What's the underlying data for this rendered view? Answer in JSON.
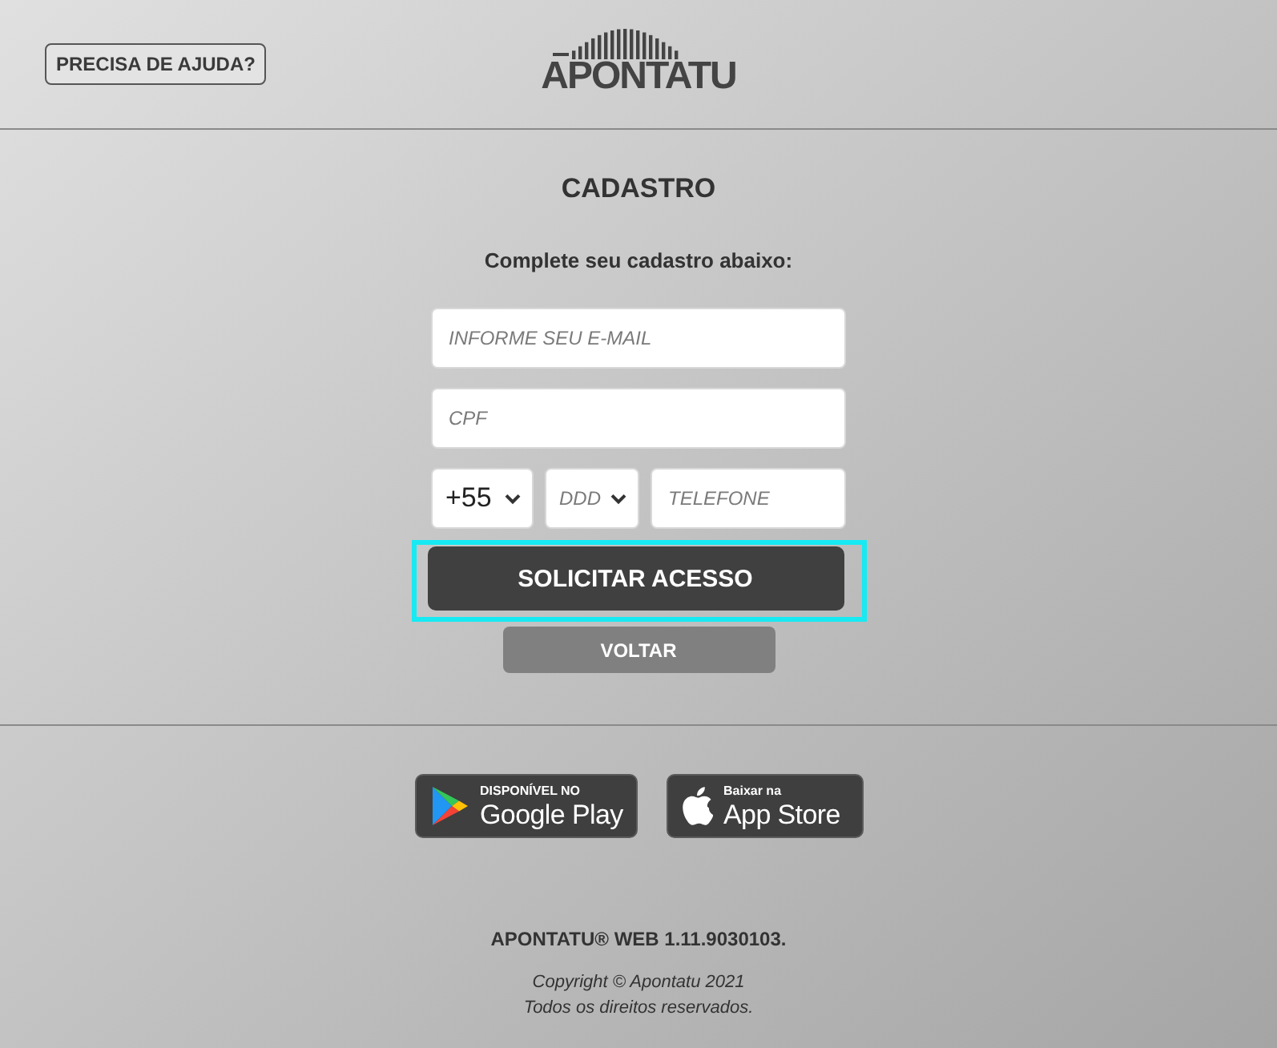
{
  "header": {
    "help_button": "PRECISA DE AJUDA?",
    "logo": "APONTATU"
  },
  "form": {
    "title": "CADASTRO",
    "subtitle": "Complete seu cadastro abaixo:",
    "email_field": {
      "placeholder": "INFORME SEU E-MAIL"
    },
    "cpf_field": {
      "placeholder": "CPF"
    },
    "country_code_select": {
      "value": "+55"
    },
    "ddd_select": {
      "placeholder": "DDD"
    },
    "phone_field": {
      "placeholder": "TELEFONE"
    },
    "submit_button": {
      "label": "SOLICITAR ACESSO",
      "focused": true
    },
    "back_button": {
      "label": "VOLTAR"
    }
  },
  "store_badges": [
    {
      "kind": "google_play",
      "caption": "DISPONÍVEL NO",
      "store": "Google Play"
    },
    {
      "kind": "app_store",
      "caption": "Baixar na",
      "store": "App Store"
    }
  ],
  "footer": {
    "version": "APONTATU® WEB 1.11.9030103.",
    "copyright": [
      "Copyright © Apontatu 2021",
      "Todos os direitos reservados."
    ]
  }
}
